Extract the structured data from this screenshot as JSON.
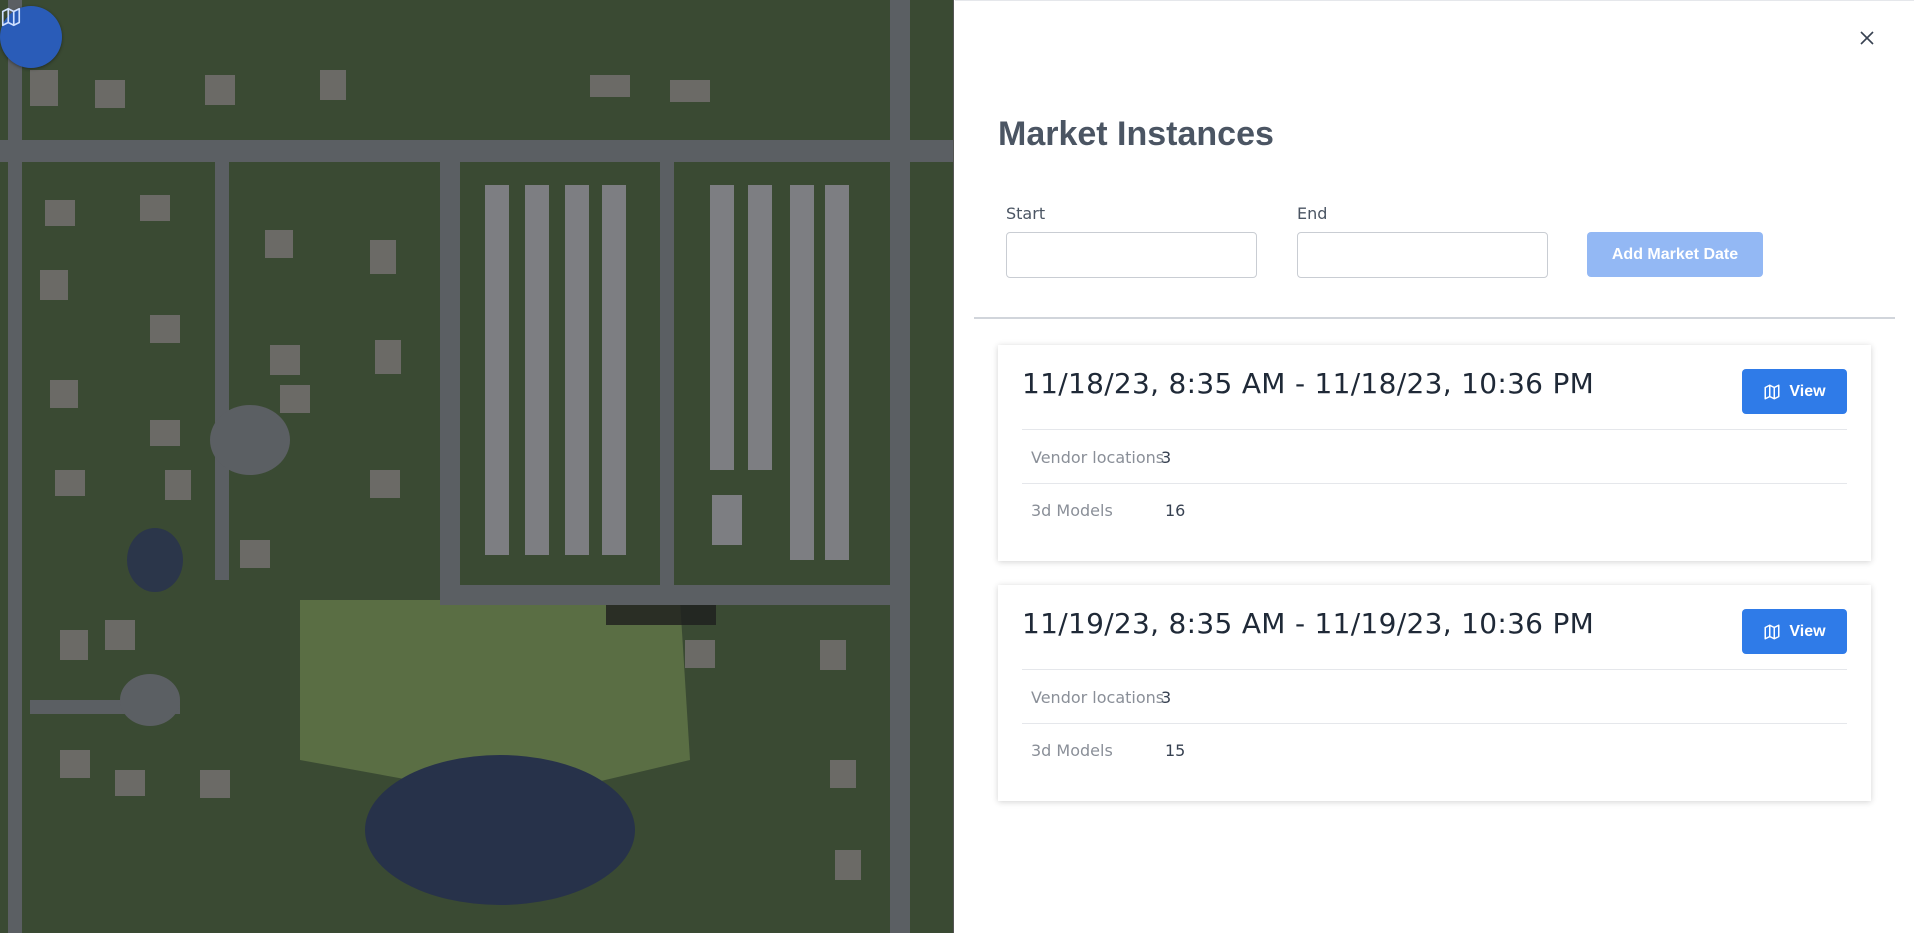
{
  "map": {
    "toggle_icon": "map-icon"
  },
  "panel": {
    "title": "Market Instances",
    "close_icon": "close-icon",
    "start_label": "Start",
    "start_value": "",
    "end_label": "End",
    "end_value": "",
    "add_button_label": "Add Market Date"
  },
  "instances": [
    {
      "title": "11/18/23, 8:35 AM - 11/18/23, 10:36 PM",
      "view_label": "View",
      "vendor_locations_label": "Vendor locations",
      "vendor_locations_value": "3",
      "models_label": "3d Models",
      "models_value": "16"
    },
    {
      "title": "11/19/23, 8:35 AM - 11/19/23, 10:36 PM",
      "view_label": "View",
      "vendor_locations_label": "Vendor locations",
      "vendor_locations_value": "3",
      "models_label": "3d Models",
      "models_value": "15"
    }
  ],
  "colors": {
    "primary": "#2f7be8",
    "primary_disabled": "#93b8f4",
    "map_button": "#2a5cb8",
    "title_text": "#4b5563"
  }
}
